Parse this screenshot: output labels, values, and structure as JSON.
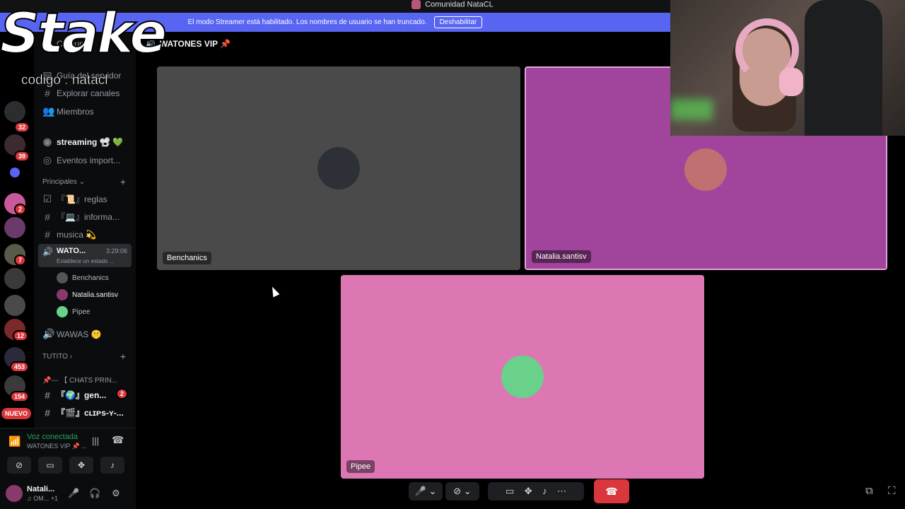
{
  "window": {
    "title": "Comunidad NataCL"
  },
  "banner": {
    "message": "El modo Streamer está habilitado. Los nombres de usuario se han truncado.",
    "disable_button": "Deshabilitar"
  },
  "overlay": {
    "logo_text": "Stake",
    "promo_code": "codigo : natacl"
  },
  "server_rail": {
    "badges": [
      "32",
      "39",
      "2",
      "7",
      "12",
      "453",
      "154"
    ],
    "new_label": "NUEVO"
  },
  "sidebar": {
    "server_name": "Comun...",
    "items": [
      {
        "label": "Guía del servidor"
      },
      {
        "label": "Explorar canales"
      },
      {
        "label": "Miembros"
      },
      {
        "label": "streaming 📽 💚"
      },
      {
        "label": "Eventos import..."
      }
    ],
    "category_principales": "Principales",
    "channels": [
      {
        "label": "『📜』reglas"
      },
      {
        "label": "『💻』informa..."
      },
      {
        "label": "musica 💫"
      }
    ],
    "active_voice": {
      "label": "WATO...",
      "time": "3:29:06",
      "status": "Establece un estado ..."
    },
    "voice_users": [
      "Benchanics",
      "Natalia.santisv",
      "Pipee"
    ],
    "other_voice": "WAWAS 🤫",
    "category_tutito": "TUTITO",
    "chats_category": "📌--- 【 CHATS PRIN...",
    "text_channels": [
      {
        "label": "『🌍』gen...",
        "badge": "2"
      },
      {
        "label": "『🎬』ᴄʟɪᴘs-ʏ-..."
      }
    ]
  },
  "voice_panel": {
    "title": "Voz conectada",
    "channel": "WATONES VIP 📌 ...",
    "user_name": "Natali...",
    "user_status": "♫ OM... +1"
  },
  "main": {
    "channel_title": "WATONES VIP 📌",
    "tiles": [
      {
        "name": "Benchanics",
        "bg": "#4a4a4a"
      },
      {
        "name": "Natalia.santisv",
        "bg": "#a0449c"
      },
      {
        "name": "Pipee",
        "bg": "#dd77b4"
      }
    ]
  },
  "colors": {
    "accent": "#5865f2",
    "danger": "#da373c",
    "online": "#23a55a"
  }
}
